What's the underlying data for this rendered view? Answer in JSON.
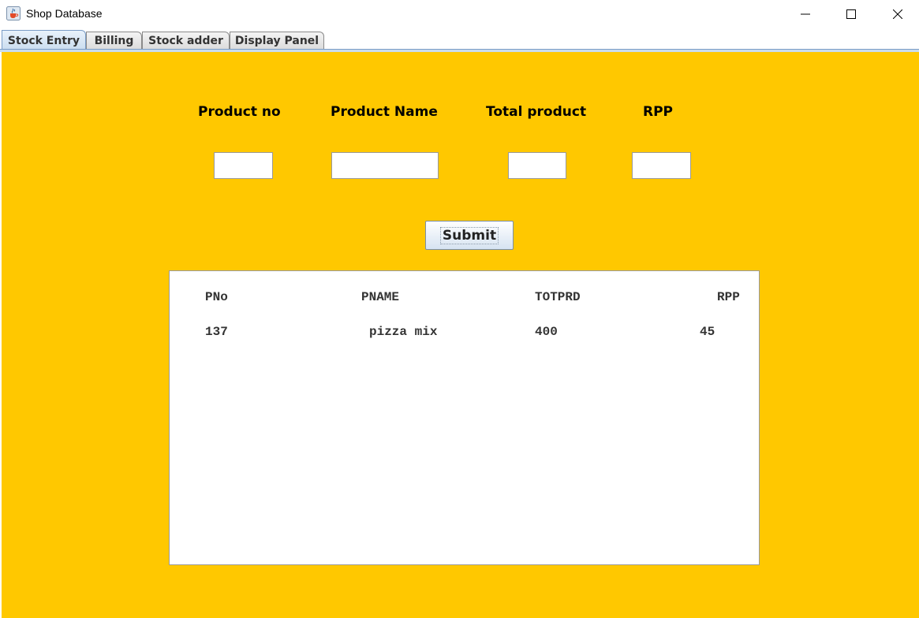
{
  "window": {
    "title": "Shop Database",
    "icon": "java-cup-icon",
    "controls": [
      "minimize-icon",
      "maximize-icon",
      "close-icon"
    ]
  },
  "tabs": [
    {
      "label": "Stock Entry",
      "active": true
    },
    {
      "label": "Billing",
      "active": false
    },
    {
      "label": "Stock adder",
      "active": false
    },
    {
      "label": "Display Panel",
      "active": false
    }
  ],
  "form": {
    "labels": {
      "product_no": "Product no",
      "product_name": "Product Name",
      "total_product": "Total product",
      "rpp": "RPP"
    },
    "values": {
      "product_no": "",
      "product_name": "",
      "total_product": "",
      "rpp": ""
    },
    "submit_label": "Submit"
  },
  "table": {
    "columns": [
      "PNo",
      "PNAME",
      "TOTPRD",
      "RPP"
    ],
    "rows": [
      [
        "137",
        "pizza mix",
        "400",
        "45"
      ]
    ]
  },
  "colors": {
    "panel_background": "#ffc800",
    "active_tab": "#c9dcef"
  }
}
